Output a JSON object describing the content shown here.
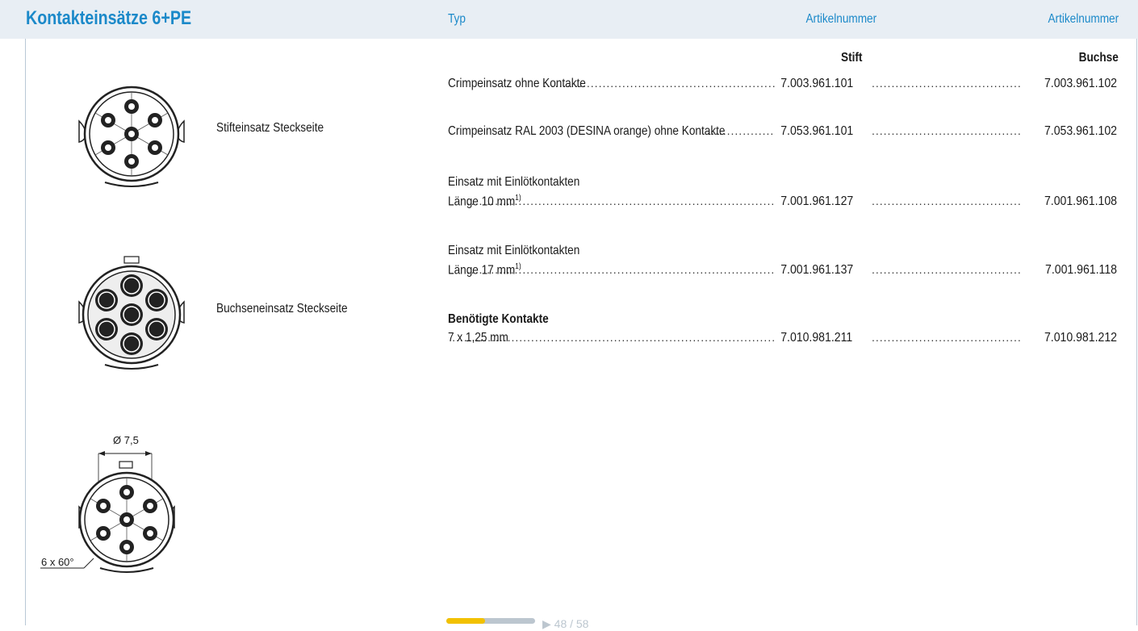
{
  "header": {
    "title": "Kontakteinsätze 6+PE",
    "col_typ": "Typ",
    "col_art1": "Artikelnummer",
    "col_art2": "Artikelnummer"
  },
  "subheads": {
    "stift": "Stift",
    "buchse": "Buchse"
  },
  "figures": {
    "pin_caption": "Stifteinsatz Steckseite",
    "socket_caption": "Buchseneinsatz Steckseite",
    "dim_diameter": "Ø 7,5",
    "dim_angle": "6 x 60°"
  },
  "rows": [
    {
      "label": "Crimpeinsatz ohne Kontakte",
      "stift": "7.003.961.101",
      "buchse": "7.003.961.102"
    },
    {
      "label": "Crimpeinsatz RAL 2003 (DESINA orange) ohne Kontakte",
      "stift": "7.053.961.101",
      "buchse": "7.053.961.102"
    },
    {
      "heading": "Einsatz mit Einlötkontakten",
      "label": "Länge 10 mm",
      "sup": "1)",
      "stift": "7.001.961.127",
      "buchse": "7.001.961.108"
    },
    {
      "heading": "Einsatz mit Einlötkontakten",
      "label": "Länge 17 mm",
      "sup": "1)",
      "stift": "7.001.961.137",
      "buchse": "7.001.961.118"
    },
    {
      "heading": "Benötigte Kontakte",
      "label": "7 x 1,25 mm",
      "stift": "7.010.981.211",
      "buchse": "7.010.981.212"
    }
  ],
  "footer": {
    "page": "▶ 48 / 58"
  },
  "colors": {
    "accent": "#1b89c9",
    "header_bg": "#e8eef4",
    "footer_yellow": "#f2c100"
  }
}
